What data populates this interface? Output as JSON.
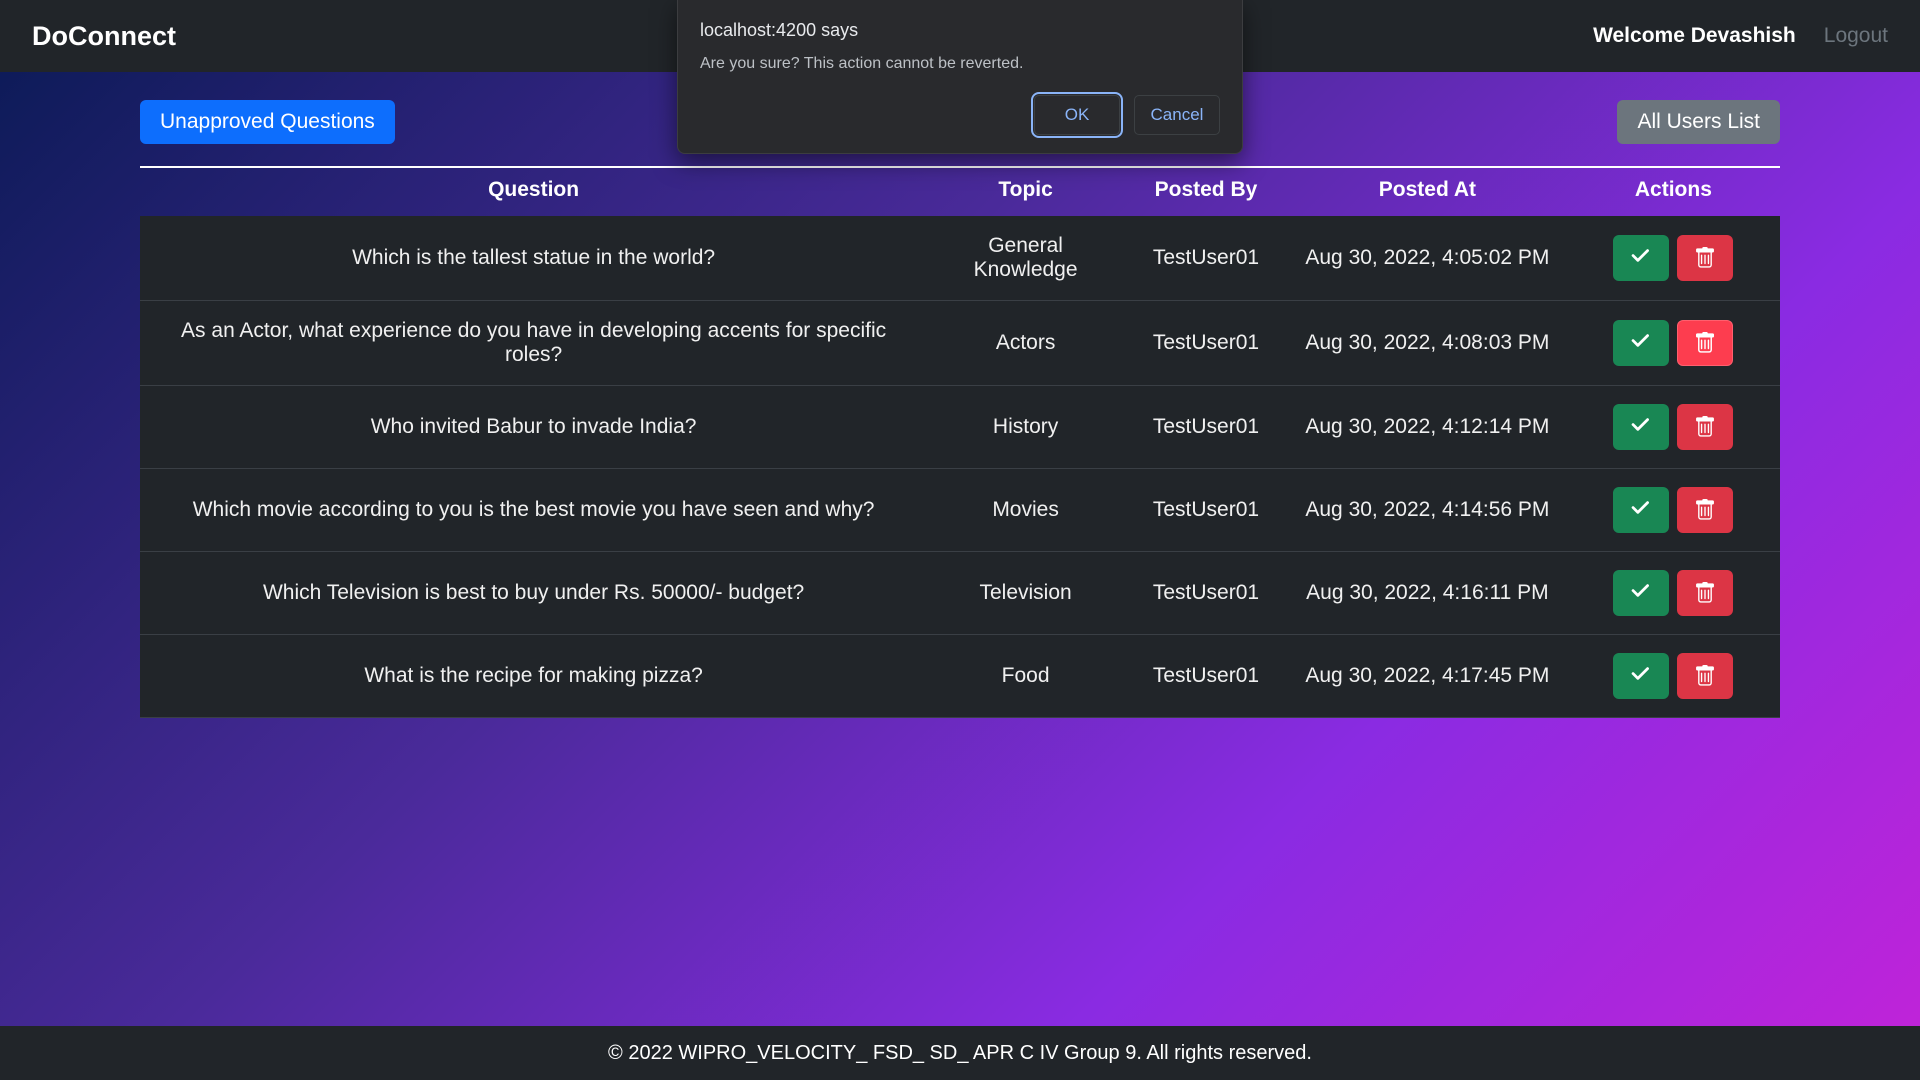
{
  "navbar": {
    "brand": "DoConnect",
    "welcome": "Welcome Devashish",
    "logout": "Logout"
  },
  "toolbar": {
    "unapproved_label": "Unapproved Questions",
    "all_users_label": "All Users List"
  },
  "table": {
    "headers": {
      "question": "Question",
      "topic": "Topic",
      "posted_by": "Posted By",
      "posted_at": "Posted At",
      "actions": "Actions"
    },
    "rows": [
      {
        "question": "Which is the tallest statue in the world?",
        "topic": "General Knowledge",
        "posted_by": "TestUser01",
        "posted_at": "Aug 30, 2022, 4:05:02 PM"
      },
      {
        "question": "As an Actor, what experience do you have in developing accents for specific roles?",
        "topic": "Actors",
        "posted_by": "TestUser01",
        "posted_at": "Aug 30, 2022, 4:08:03 PM"
      },
      {
        "question": "Who invited Babur to invade India?",
        "topic": "History",
        "posted_by": "TestUser01",
        "posted_at": "Aug 30, 2022, 4:12:14 PM"
      },
      {
        "question": "Which movie according to you is the best movie you have seen and why?",
        "topic": "Movies",
        "posted_by": "TestUser01",
        "posted_at": "Aug 30, 2022, 4:14:56 PM"
      },
      {
        "question": "Which Television is best to buy under Rs. 50000/- budget?",
        "topic": "Television",
        "posted_by": "TestUser01",
        "posted_at": "Aug 30, 2022, 4:16:11 PM"
      },
      {
        "question": "What is the recipe for making pizza?",
        "topic": "Food",
        "posted_by": "TestUser01",
        "posted_at": "Aug 30, 2022, 4:17:45 PM"
      }
    ],
    "delete_hover_row_index": 1
  },
  "dialog": {
    "title": "localhost:4200 says",
    "message": "Are you sure? This action cannot be reverted.",
    "ok": "OK",
    "cancel": "Cancel"
  },
  "footer": {
    "text": "© 2022 WIPRO_VELOCITY_ FSD_ SD_ APR C IV Group 9. All rights reserved."
  }
}
